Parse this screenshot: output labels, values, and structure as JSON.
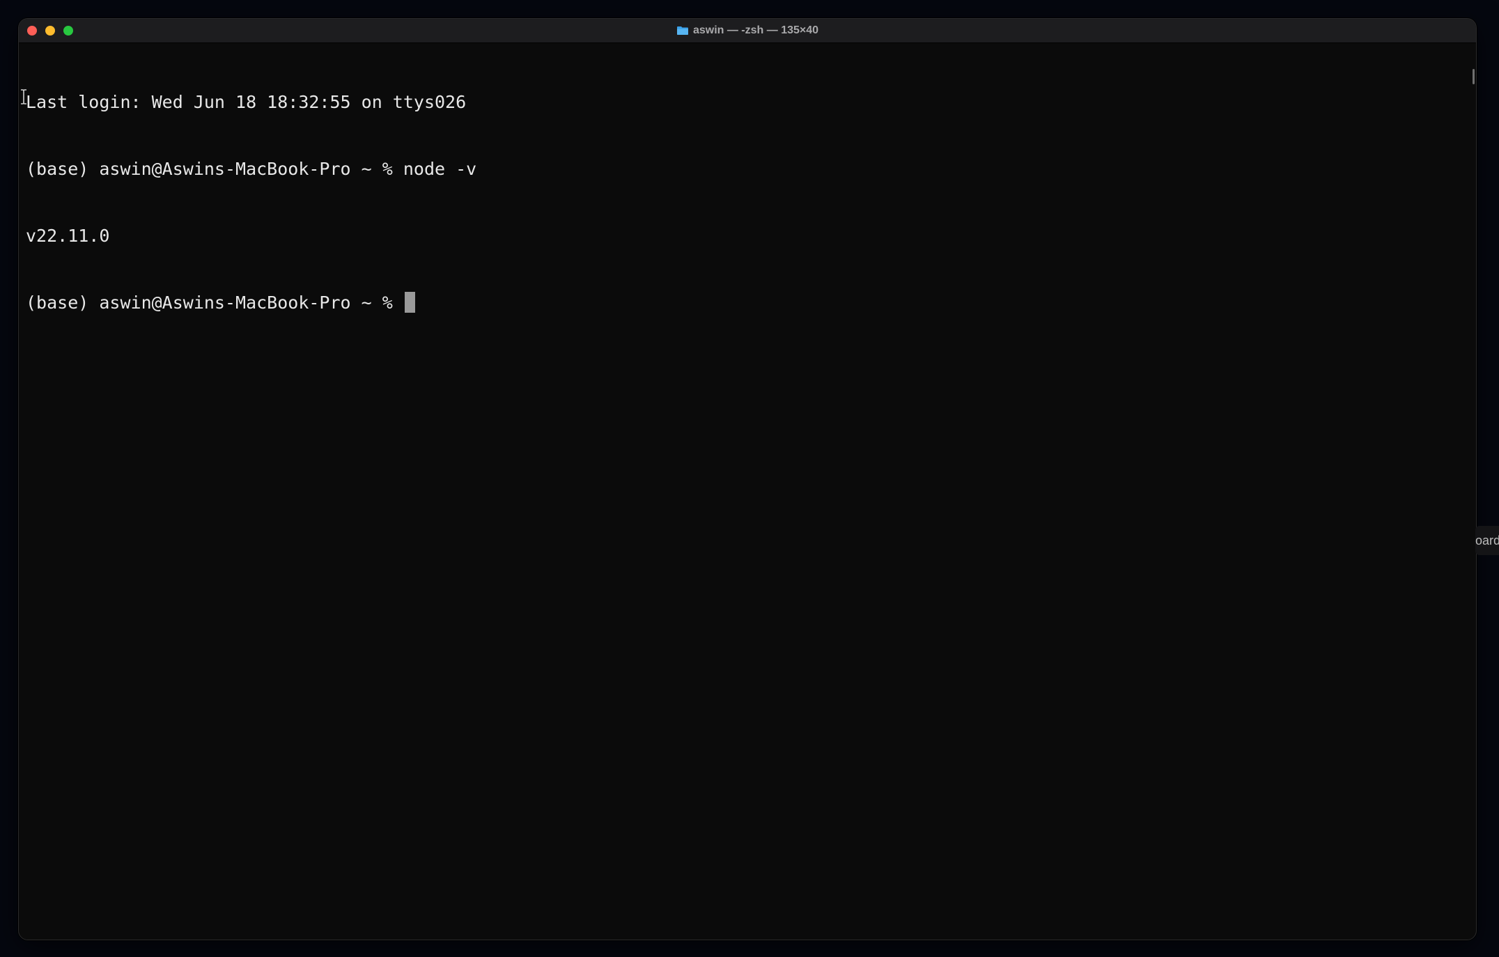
{
  "window": {
    "title": "aswin — -zsh — 135×40",
    "title_icon": "folder-icon"
  },
  "terminal": {
    "lines": [
      "Last login: Wed Jun 18 18:32:55 on ttys026",
      "(base) aswin@Aswins-MacBook-Pro ~ % node -v",
      "v22.11.0"
    ],
    "prompt": "(base) aswin@Aswins-MacBook-Pro ~ % "
  },
  "edge_tab": {
    "label": "oard"
  },
  "colors": {
    "close": "#ff5f57",
    "minimize": "#febc2e",
    "maximize": "#28c840",
    "terminal_bg": "#0b0b0b",
    "terminal_fg": "#e8e8e8"
  }
}
